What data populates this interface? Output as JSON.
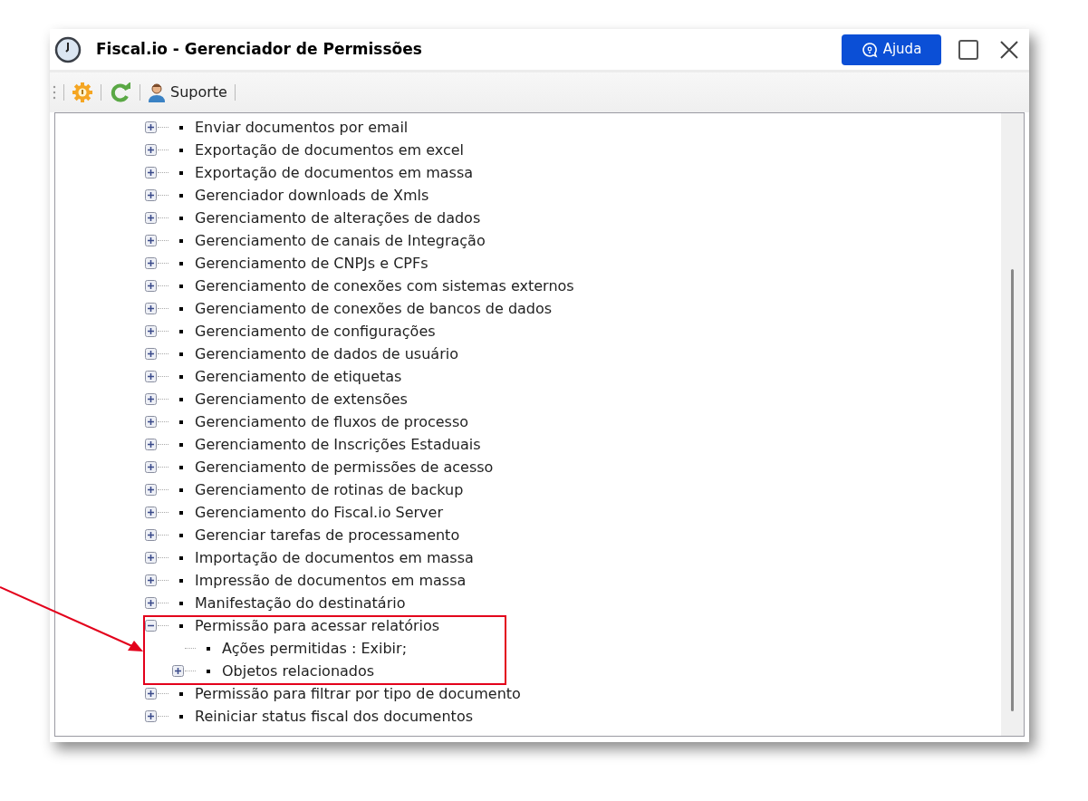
{
  "window": {
    "title": "Fiscal.io - Gerenciador de Permissões",
    "help_button": "Ajuda"
  },
  "toolbar": {
    "items": [
      {
        "kind": "settings"
      },
      {
        "kind": "refresh"
      },
      {
        "kind": "support",
        "label": "Suporte"
      }
    ]
  },
  "tree": {
    "items": [
      {
        "label": "Enviar documentos por email",
        "expanded": false
      },
      {
        "label": "Exportação de documentos em excel",
        "expanded": false
      },
      {
        "label": "Exportação de documentos em massa",
        "expanded": false
      },
      {
        "label": "Gerenciador downloads de Xmls",
        "expanded": false
      },
      {
        "label": "Gerenciamento de alterações de dados",
        "expanded": false
      },
      {
        "label": "Gerenciamento de canais de Integração",
        "expanded": false
      },
      {
        "label": "Gerenciamento de CNPJs e CPFs",
        "expanded": false
      },
      {
        "label": "Gerenciamento de conexões com sistemas externos",
        "expanded": false
      },
      {
        "label": "Gerenciamento de conexões de bancos de dados",
        "expanded": false
      },
      {
        "label": "Gerenciamento de configurações",
        "expanded": false
      },
      {
        "label": "Gerenciamento de dados de usuário",
        "expanded": false
      },
      {
        "label": "Gerenciamento de etiquetas",
        "expanded": false
      },
      {
        "label": "Gerenciamento de extensões",
        "expanded": false
      },
      {
        "label": "Gerenciamento de fluxos de processo",
        "expanded": false
      },
      {
        "label": "Gerenciamento de Inscrições Estaduais",
        "expanded": false
      },
      {
        "label": "Gerenciamento de permissões de acesso",
        "expanded": false
      },
      {
        "label": "Gerenciamento de rotinas de backup",
        "expanded": false
      },
      {
        "label": "Gerenciamento do Fiscal.io Server",
        "expanded": false
      },
      {
        "label": "Gerenciar tarefas de processamento",
        "expanded": false
      },
      {
        "label": "Importação de documentos em massa",
        "expanded": false
      },
      {
        "label": "Impressão de documentos em massa",
        "expanded": false
      },
      {
        "label": "Manifestação do destinatário",
        "expanded": false
      },
      {
        "label": "Permissão para acessar relatórios",
        "expanded": true,
        "children": [
          {
            "label": "Ações permitidas : Exibir;"
          },
          {
            "label": "Objetos relacionados",
            "expanded": false
          }
        ]
      },
      {
        "label": "Permissão para filtrar por tipo de documento",
        "expanded": false
      },
      {
        "label": "Reiniciar status fiscal dos documentos",
        "expanded": false
      }
    ]
  }
}
